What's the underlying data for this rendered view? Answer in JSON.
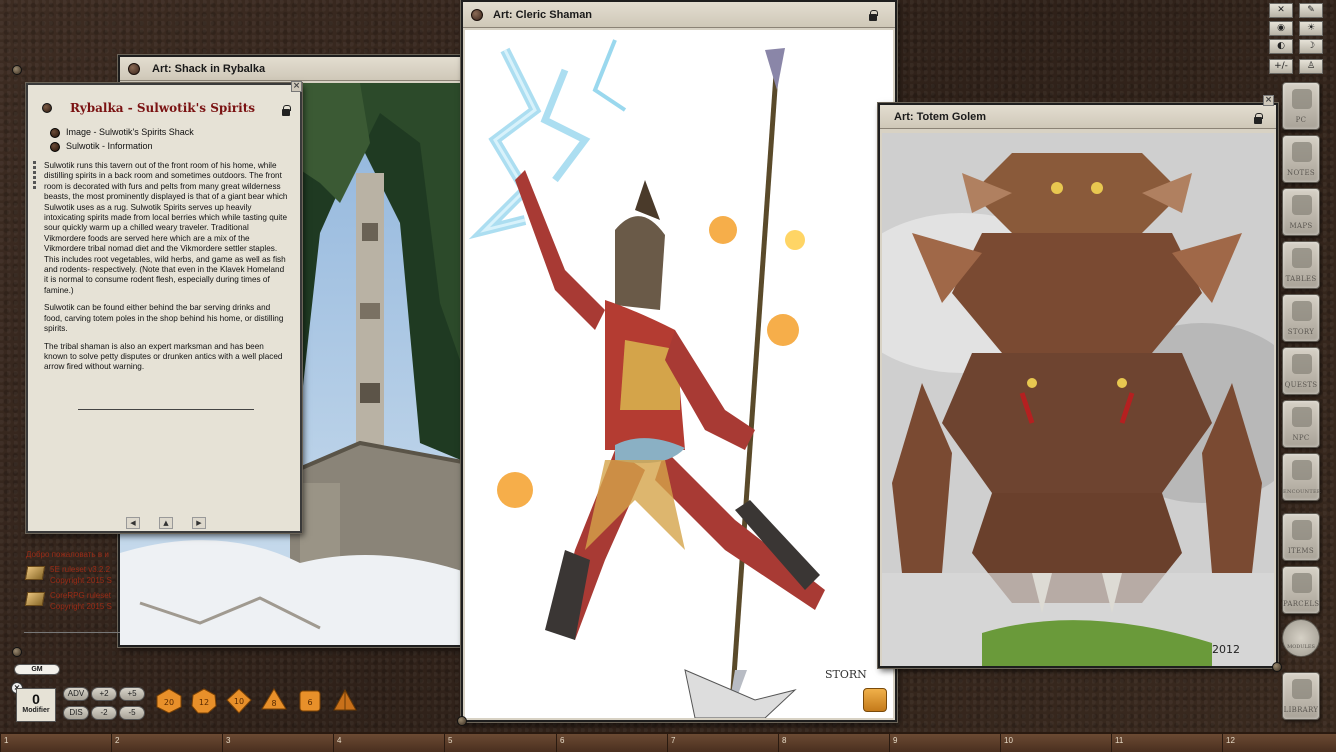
{
  "windows": {
    "shack": {
      "title": "Art: Shack in Rybalka"
    },
    "cleric": {
      "title": "Art: Cleric Shaman",
      "signature": "STORN"
    },
    "golem": {
      "title": "Art: Totem Golem",
      "signature": "2012"
    },
    "story": {
      "title": "Rybalka - Sulwotik's Spirits",
      "links": [
        "Image - Sulwotik's Spirits Shack",
        "Sulwotik - Information"
      ],
      "paragraphs": [
        "Sulwotik runs this tavern out of the front room of his home, while distilling spirits in a back room and sometimes outdoors. The front room is decorated with furs and pelts from many great wilderness beasts, the most prominently displayed is that of a giant bear which Sulwotik uses as a rug. Sulwotik Spirits serves up heavily intoxicating spirits made from local berries which while tasting quite sour quickly warm up a chilled weary traveler. Traditional Vikmordere foods are served here which are a mix of the Vikmordere tribal nomad diet and the Vikmordere settler staples. This includes root vegetables, wild herbs, and game as well as fish and rodents- respectively. (Note that even in the Klavek Homeland it is normal to consume rodent flesh, especially during times of famine.)",
        "Sulwotik can be found either behind the bar serving drinks and food, carving totem poles in the shop behind his home, or distilling spirits.",
        "The tribal shaman is also an expert marksman and has been known to solve petty disputes or drunken antics with a well placed arrow fired without warning."
      ],
      "nav": [
        "◀",
        "▲",
        "▶"
      ]
    }
  },
  "chat": {
    "welcome": "Добро пожаловать в и",
    "entries": [
      {
        "line1": "5E ruleset v3.2.2",
        "line2": "Copyright 2015 S"
      },
      {
        "line1": "CoreRPG ruleset",
        "line2": "Copyright 2015 S"
      }
    ]
  },
  "identity": {
    "label": "GM"
  },
  "modifier": {
    "value": "0",
    "label": "Modifier"
  },
  "mod_buttons": [
    {
      "label": "ADV"
    },
    {
      "label": "+2"
    },
    {
      "label": "+5"
    },
    {
      "label": "DIS"
    },
    {
      "label": "-2"
    },
    {
      "label": "-5"
    }
  ],
  "dice": [
    {
      "name": "d20",
      "value": "20"
    },
    {
      "name": "d12",
      "value": "12"
    },
    {
      "name": "d10",
      "value": "10"
    },
    {
      "name": "d8",
      "value": "8"
    },
    {
      "name": "d6",
      "value": "6"
    },
    {
      "name": "d4",
      "value": ""
    }
  ],
  "toolbar": [
    "✕",
    "✎",
    "◉",
    "☀",
    "◐",
    "☽",
    "◎",
    "☆",
    "+/-",
    "♙"
  ],
  "sidebar": [
    "PC",
    "NOTES",
    "MAPS",
    "TABLES",
    "STORY",
    "QUESTS",
    "NPC",
    "ENCOUNTER",
    "ITEMS",
    "PARCELS",
    "MODULES",
    "LIBRARY"
  ],
  "ruler": [
    "1",
    "2",
    "3",
    "4",
    "5",
    "6",
    "7",
    "8",
    "9",
    "10",
    "11",
    "12"
  ],
  "colors": {
    "story_title": "#7a1212",
    "chat_text": "#9a2b16",
    "dice": "#e8902a"
  }
}
